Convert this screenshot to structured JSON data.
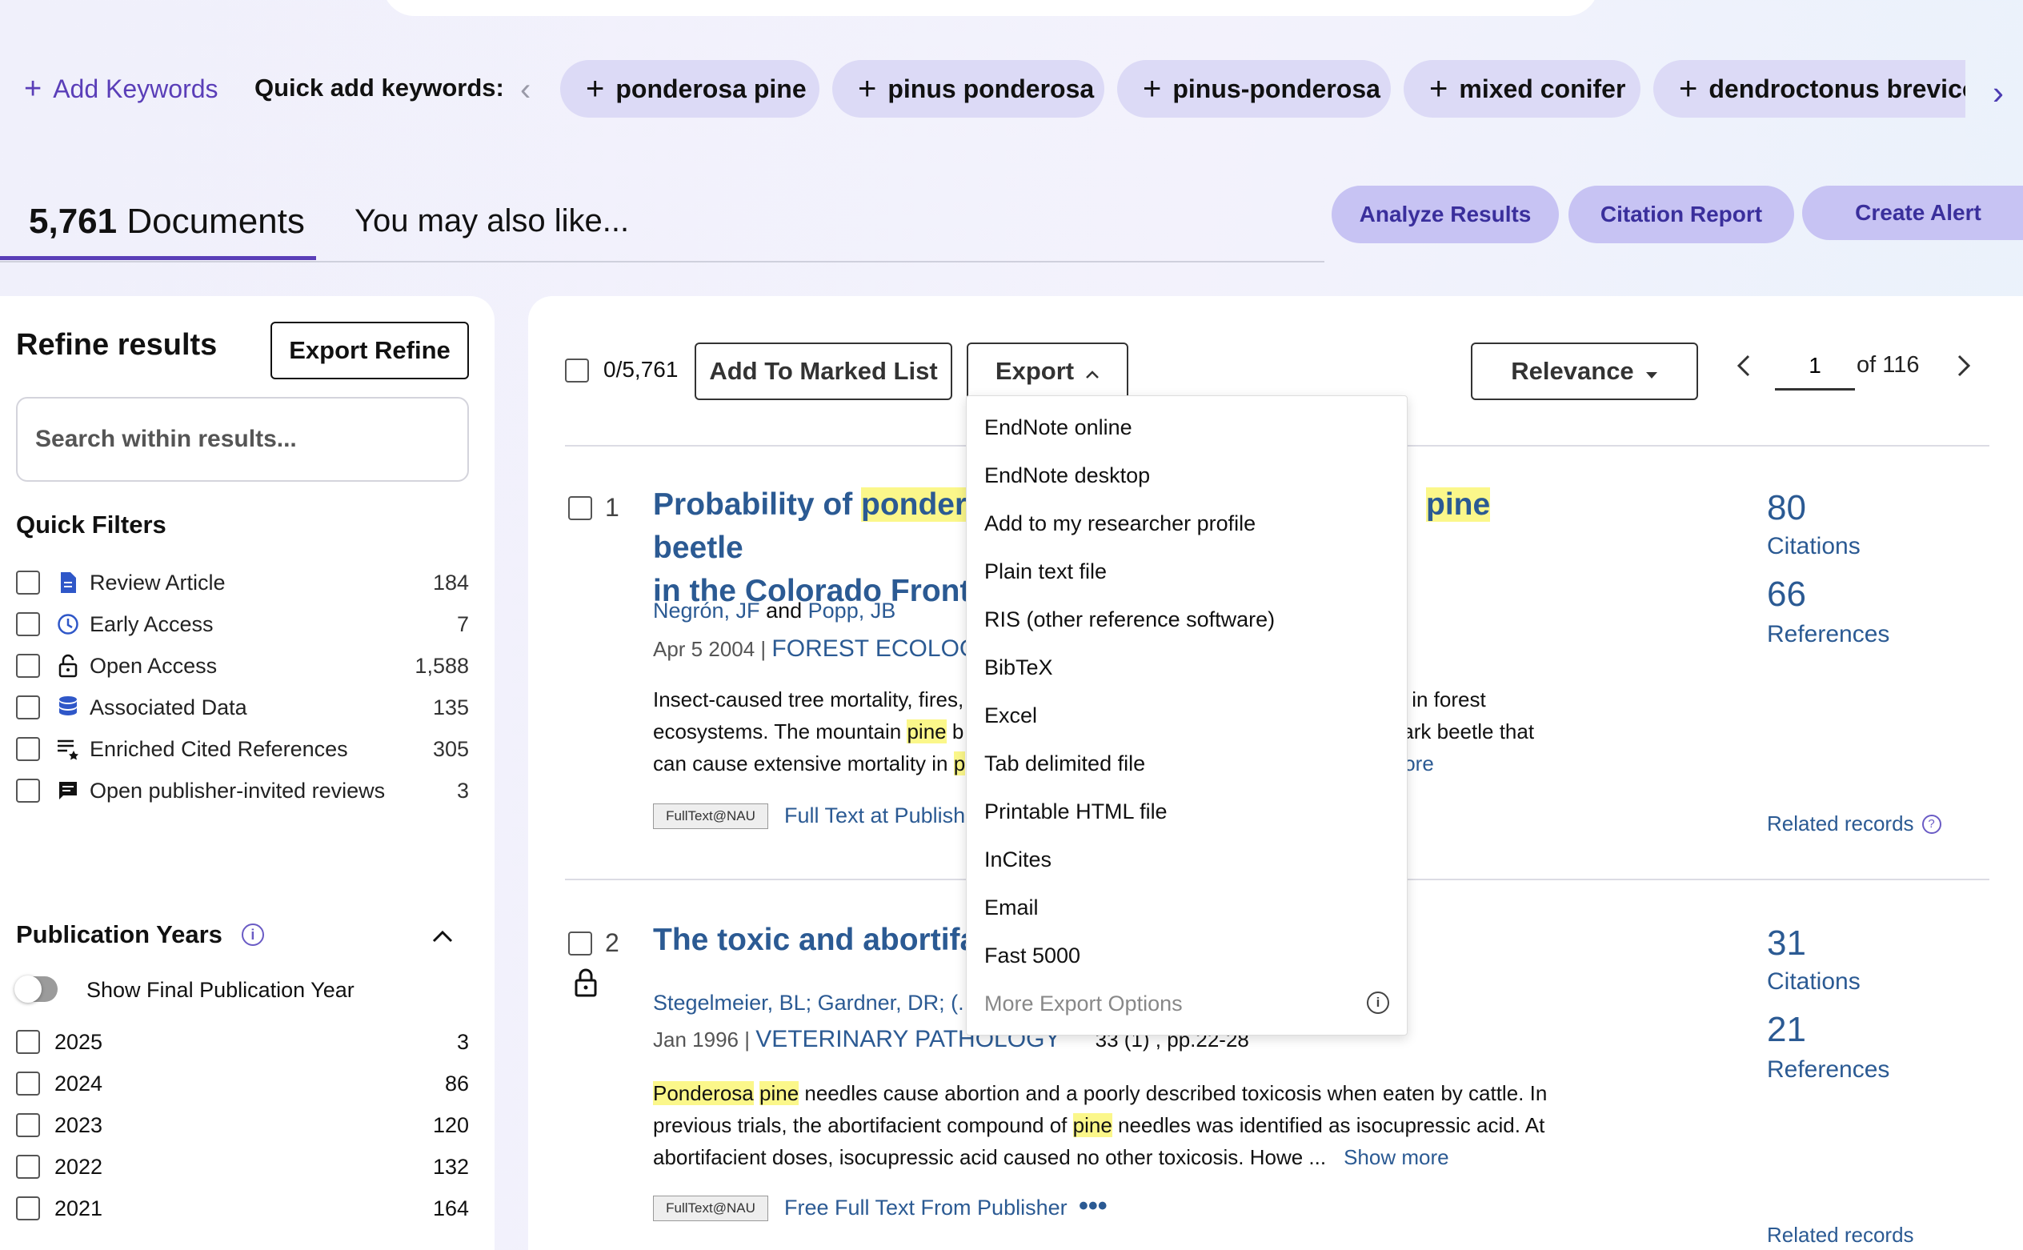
{
  "keywords": {
    "add_label": "Add Keywords",
    "quick_label": "Quick add keywords:",
    "chips": [
      "ponderosa pine",
      "pinus ponderosa",
      "pinus-ponderosa",
      "mixed conifer",
      "dendroctonus brevicor"
    ]
  },
  "tabs": {
    "count": "5,761",
    "documents": "Documents",
    "also_like": "You may also like..."
  },
  "actions": {
    "analyze": "Analyze Results",
    "citation": "Citation Report",
    "alert": "Create Alert"
  },
  "refine": {
    "title": "Refine results",
    "export_button": "Export Refine",
    "search_placeholder": "Search within results...",
    "quick_filters_title": "Quick Filters",
    "filters": [
      {
        "label": "Review Article",
        "count": "184",
        "icon": "document-icon"
      },
      {
        "label": "Early Access",
        "count": "7",
        "icon": "clock-icon"
      },
      {
        "label": "Open Access",
        "count": "1,588",
        "icon": "unlock-icon"
      },
      {
        "label": "Associated Data",
        "count": "135",
        "icon": "database-icon"
      },
      {
        "label": "Enriched Cited References",
        "count": "305",
        "icon": "list-star-icon"
      },
      {
        "label": "Open publisher-invited reviews",
        "count": "3",
        "icon": "comment-icon"
      }
    ],
    "pub_years_title": "Publication Years",
    "toggle_label": "Show Final Publication Year",
    "years": [
      {
        "year": "2025",
        "count": "3"
      },
      {
        "year": "2024",
        "count": "86"
      },
      {
        "year": "2023",
        "count": "120"
      },
      {
        "year": "2022",
        "count": "132"
      },
      {
        "year": "2021",
        "count": "164"
      }
    ]
  },
  "toolbar": {
    "selected": "0/5,761",
    "marked_list": "Add To Marked List",
    "export": "Export",
    "sort": "Relevance",
    "page": "1",
    "of": "of",
    "total_pages": "116"
  },
  "export_menu": [
    "EndNote online",
    "EndNote desktop",
    "Add to my researcher profile",
    "Plain text file",
    "RIS (other reference software)",
    "BibTeX",
    "Excel",
    "Tab delimited file",
    "Printable HTML file",
    "InCites",
    "Email",
    "Fast 5000",
    "More Export Options"
  ],
  "records": [
    {
      "num": "1",
      "title_a": "Probability of ",
      "title_hl1": "pondero",
      "title_hl2": "pine",
      "title_b": " beetle",
      "title_line2": "in the Colorado Front R",
      "author1": "Negrón, JF",
      "and": "and",
      "author2": "Popp, JB",
      "date": "Apr 5 2004 |",
      "journal": "FOREST ECOLOGY A",
      "abs1a": "Insect-caused tree mortality, fires,",
      "abs1b": "in forest",
      "abs2a": "ecosystems. The mountain ",
      "abs2hl": "pine",
      "abs2b": " b",
      "abs2c": "ark beetle that",
      "abs3a": "can cause extensive mortality in ",
      "abs3hl": "p",
      "abs3b": "ore",
      "badge": "FullText@NAU",
      "ft_link": "Full Text at Publishe",
      "citations": "80",
      "citations_label": "Citations",
      "references": "66",
      "references_label": "References",
      "related": "Related records"
    },
    {
      "num": "2",
      "title": "The toxic and abortifac",
      "authors": "Stegelmeier, BL; Gardner, DR; (...);",
      "date": "Jan 1996 |",
      "journal": "VETERINARY PATHOLOGY",
      "volume": "33 (1) , pp.22-28",
      "abs_hl1": "Ponderosa",
      "abs_hl2": "pine",
      "abs1": " needles cause abortion and a poorly described toxicosis when eaten by cattle. In",
      "abs2a": "previous trials, the abortifacient compound of ",
      "abs2hl": "pine",
      "abs2b": " needles was identified as isocupressic acid. At",
      "abs3": "abortifacient doses, isocupressic acid caused no other toxicosis. Howe ...",
      "show_more": "Show more",
      "badge": "FullText@NAU",
      "ft_link": "Free Full Text From Publisher",
      "citations": "31",
      "citations_label": "Citations",
      "references": "21",
      "references_label": "References",
      "related": "Related records"
    }
  ]
}
